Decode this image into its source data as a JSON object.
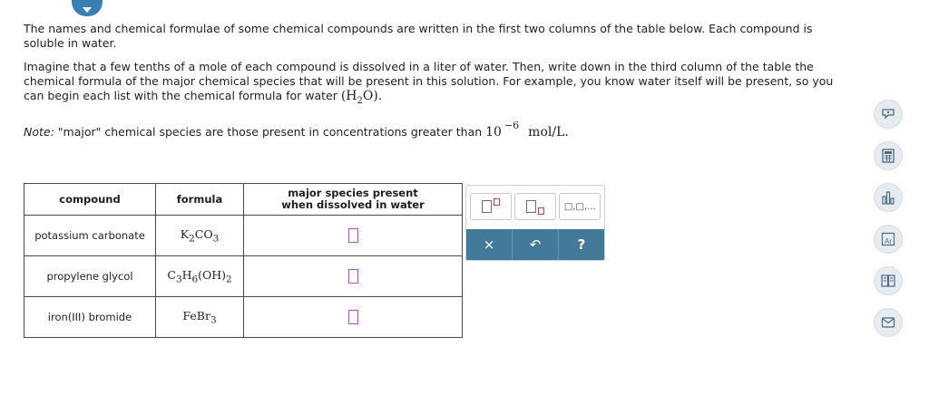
{
  "prompt": {
    "para1": "The names and chemical formulae of some chemical compounds are written in the first two columns of the table below. Each compound is soluble in water.",
    "para2_text": "Imagine that a few tenths of a mole of each compound is dissolved in a liter of water. Then, write down in the third column of the table the chemical formula of the major chemical species that will be present in this solution. For example, you know water itself will be present, so you can begin each list with the chemical formula for water",
    "water_formula": "(H2O).",
    "note_label": "Note:",
    "note_text": "\"major\" chemical species are those present in concentrations greater than",
    "note_base": "10",
    "note_exponent": "−6",
    "note_unit": "mol/L."
  },
  "table": {
    "headers": [
      "compound",
      "formula",
      "major species present when dissolved in water"
    ],
    "rows": [
      {
        "compound": "potassium carbonate",
        "formula": "K2CO3"
      },
      {
        "compound": "propylene glycol",
        "formula": "C3H6(OH)2"
      },
      {
        "compound": "iron(III) bromide",
        "formula": "FeBr3"
      }
    ]
  },
  "palette": {
    "buttons": [
      "superscript-template",
      "subscript-template",
      "list-template"
    ],
    "list_glyph": "□,□,...",
    "actions": {
      "clear": "×",
      "undo": "↶",
      "help": "?"
    }
  },
  "side_tools": [
    "explanation-icon",
    "calculator-icon",
    "data-chart-icon",
    "periodic-table-icon",
    "textbook-icon",
    "message-icon"
  ],
  "side_tool_labels": {
    "periodic": "Ar"
  },
  "colors": {
    "accent": "#447a99",
    "answer_box": "#b34ad3",
    "top_toggle": "#3a7fb4"
  }
}
